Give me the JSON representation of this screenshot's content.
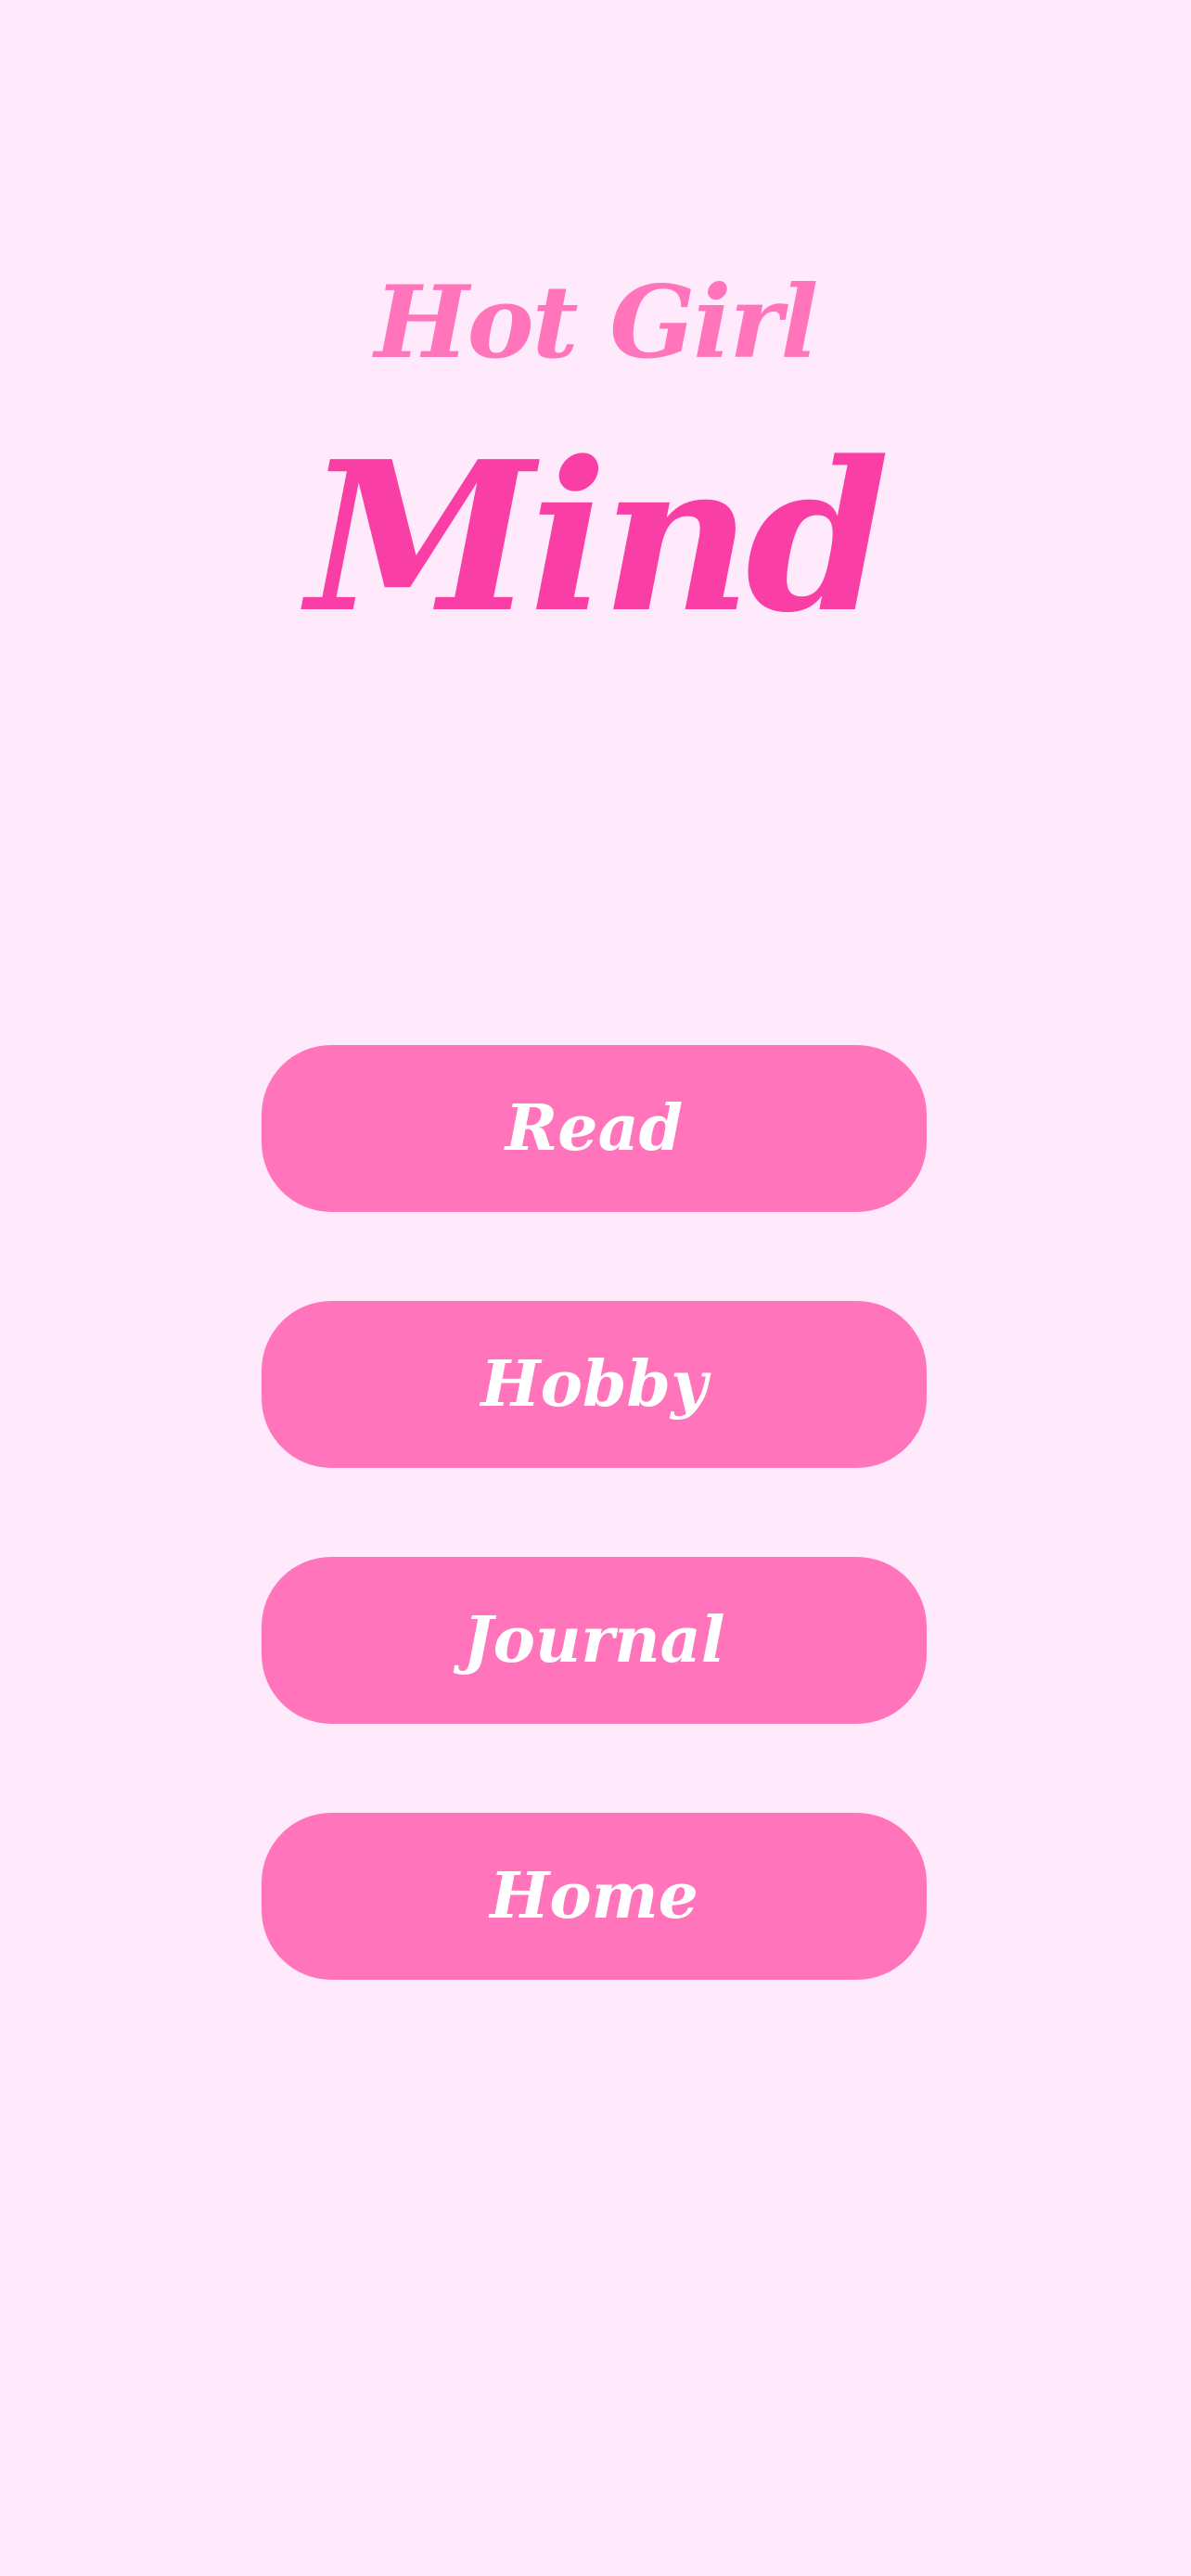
{
  "header": {
    "subtitle": "Hot Girl",
    "title": "Mind"
  },
  "menu": {
    "read_label": "Read",
    "hobby_label": "Hobby",
    "journal_label": "Journal",
    "home_label": "Home"
  },
  "colors": {
    "background": "#FFEAFC",
    "title_primary": "#F93EA6",
    "title_secondary": "#FF74BA",
    "button_fill": "#FF74BA",
    "button_text": "#FFFFFF"
  }
}
